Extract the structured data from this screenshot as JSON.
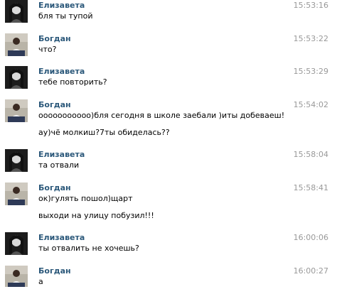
{
  "messages": [
    {
      "author": "Елизавета",
      "time": "15:53:16",
      "avatar": "elizaveta-avatar",
      "lines": [
        "бля ты тупой"
      ]
    },
    {
      "author": "Богдан",
      "time": "15:53:22",
      "avatar": "bogdan-avatar",
      "lines": [
        "что?"
      ]
    },
    {
      "author": "Елизавета",
      "time": "15:53:29",
      "avatar": "elizaveta-avatar",
      "lines": [
        "тебе повторить?"
      ]
    },
    {
      "author": "Богдан",
      "time": "15:54:02",
      "avatar": "bogdan-avatar",
      "lines": [
        "ооооооооооо)бля сегодня в школе заебали )иты добеваеш!",
        "ау)чё молкиш?7ты обиделась??"
      ]
    },
    {
      "author": "Елизавета",
      "time": "15:58:04",
      "avatar": "elizaveta-avatar",
      "lines": [
        "та отвали"
      ]
    },
    {
      "author": "Богдан",
      "time": "15:58:41",
      "avatar": "bogdan-avatar",
      "lines": [
        "ок)гулять пошол)щарт",
        "выходи на улицу побузил!!!"
      ]
    },
    {
      "author": "Елизавета",
      "time": "16:00:06",
      "avatar": "elizaveta-avatar",
      "lines": [
        "ты отвалить не хочешь?"
      ]
    },
    {
      "author": "Богдан",
      "time": "16:00:27",
      "avatar": "bogdan-avatar",
      "lines": [
        "а"
      ]
    }
  ],
  "colors": {
    "author": "#2b587a",
    "time": "#999999"
  }
}
